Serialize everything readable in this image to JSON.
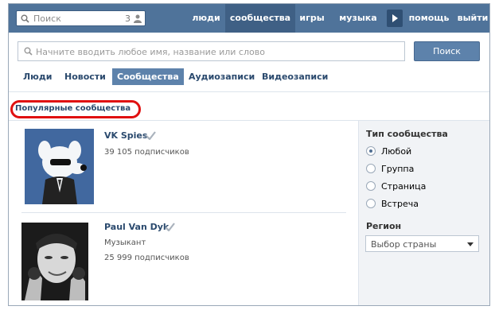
{
  "header": {
    "search_placeholder": "Поиск",
    "search_count": "3",
    "nav": [
      {
        "label": "люди",
        "active": false
      },
      {
        "label": "сообщества",
        "active": true
      },
      {
        "label": "игры",
        "active": false
      },
      {
        "label": "музыка",
        "active": false
      },
      {
        "label": "помощь",
        "active": false
      },
      {
        "label": "выйти",
        "active": false
      }
    ]
  },
  "search": {
    "placeholder": "Начните вводить любое имя, название или слово",
    "button_label": "Поиск"
  },
  "tabs": [
    {
      "label": "Люди",
      "active": false
    },
    {
      "label": "Новости",
      "active": false
    },
    {
      "label": "Сообщества",
      "active": true
    },
    {
      "label": "Аудиозаписи",
      "active": false
    },
    {
      "label": "Видеозаписи",
      "active": false
    }
  ],
  "popular": {
    "title": "Популярные сообщества"
  },
  "results": [
    {
      "name": "VK Spies",
      "verified": true,
      "category": "",
      "subscribers": "39 105 подписчиков"
    },
    {
      "name": "Paul Van Dyk",
      "verified": true,
      "category": "Музыкант",
      "subscribers": "25 999 подписчиков"
    }
  ],
  "filter": {
    "type_heading": "Тип сообщества",
    "types": [
      {
        "label": "Любой",
        "selected": true
      },
      {
        "label": "Группа",
        "selected": false
      },
      {
        "label": "Страница",
        "selected": false
      },
      {
        "label": "Встреча",
        "selected": false
      }
    ],
    "region_heading": "Регион",
    "region_value": "Выбор страны"
  },
  "colors": {
    "header_bg": "#4f739a",
    "accent": "#5d82ab",
    "link": "#2b4a6e",
    "highlight_oval": "#e01010"
  }
}
